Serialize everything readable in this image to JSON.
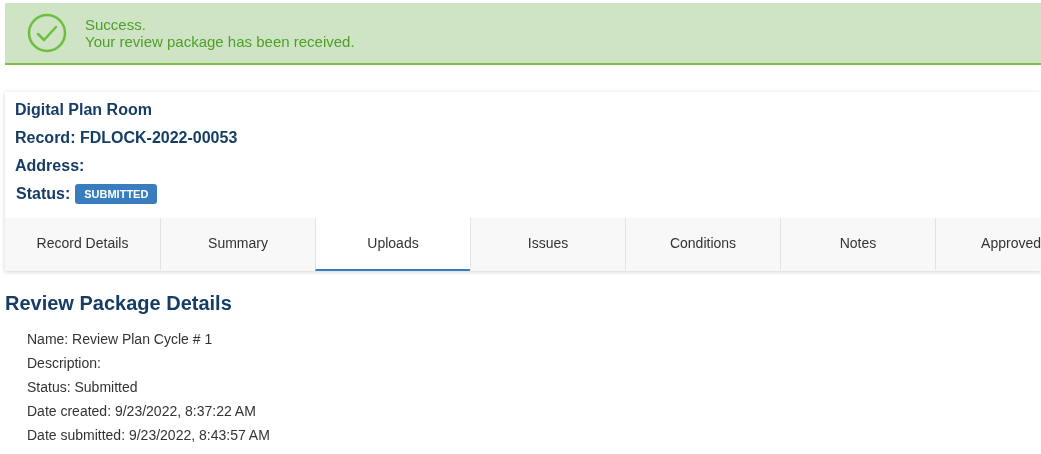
{
  "alert": {
    "title": "Success.",
    "message": "Your review package has been received."
  },
  "record": {
    "heading": "Digital Plan Room",
    "record": "Record: FDLOCK-2022-00053",
    "address": "Address:",
    "status_label": "Status:",
    "status_badge": "SUBMITTED"
  },
  "tabs": [
    {
      "label": "Record Details",
      "selected": false
    },
    {
      "label": "Summary",
      "selected": false
    },
    {
      "label": "Uploads",
      "selected": true
    },
    {
      "label": "Issues",
      "selected": false
    },
    {
      "label": "Conditions",
      "selected": false
    },
    {
      "label": "Notes",
      "selected": false
    },
    {
      "label": "Approved",
      "selected": false
    }
  ],
  "details": {
    "title": "Review Package Details",
    "lines": [
      "Name: Review Plan Cycle # 1",
      "Description:",
      "Status: Submitted",
      "Date created: 9/23/2022, 8:37:22 AM",
      "Date submitted: 9/23/2022, 8:43:57 AM"
    ]
  }
}
